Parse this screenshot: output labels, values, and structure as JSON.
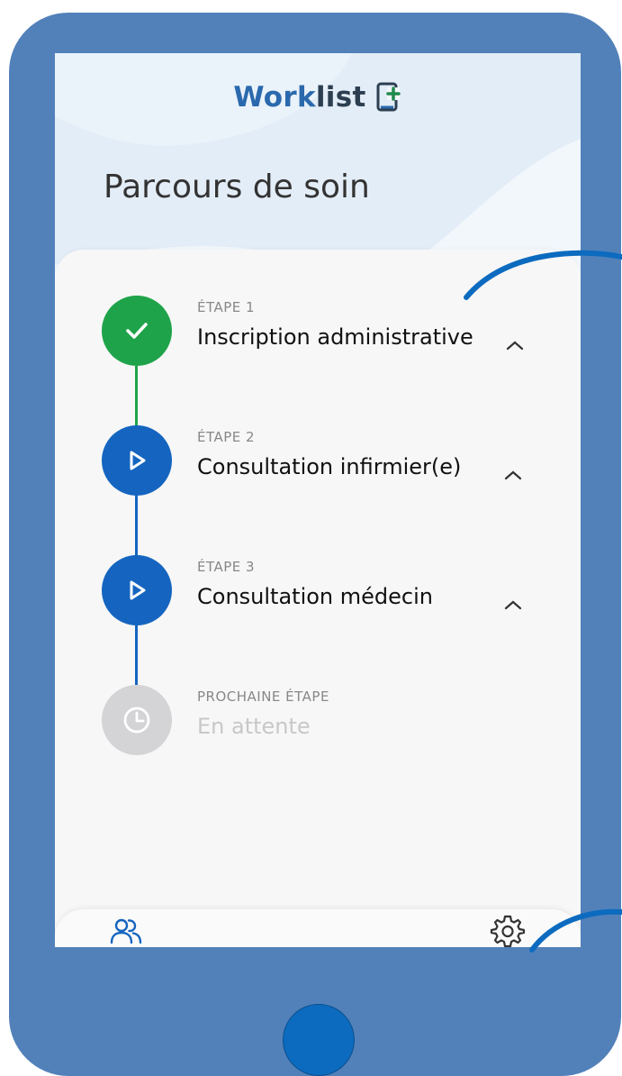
{
  "app": {
    "logo_part1": "Work",
    "logo_part2": "list",
    "logo_icon": "document-plus-icon"
  },
  "page_title": "Parcours de soin",
  "steps": [
    {
      "label": "ÉTAPE 1",
      "title": "Inscription administrative",
      "status": "completed",
      "icon": "check-icon",
      "color": "#1fa34a"
    },
    {
      "label": "ÉTAPE 2",
      "title": "Consultation infirmier(e)",
      "status": "in-progress",
      "icon": "play-icon",
      "color": "#1565c0"
    },
    {
      "label": "ÉTAPE 3",
      "title": "Consultation médecin",
      "status": "in-progress",
      "icon": "play-icon",
      "color": "#1565c0"
    },
    {
      "label": "PROCHAINE ÉTAPE",
      "title": "En attente",
      "status": "pending",
      "icon": "clock-icon",
      "color": "#d4d4d6"
    }
  ],
  "bottom_nav": {
    "left_icon": "users-icon",
    "right_icon": "gear-icon"
  },
  "colors": {
    "frame": "#5281ba",
    "accent": "#1565c0",
    "success": "#1fa34a",
    "pending": "#d4d4d6"
  }
}
